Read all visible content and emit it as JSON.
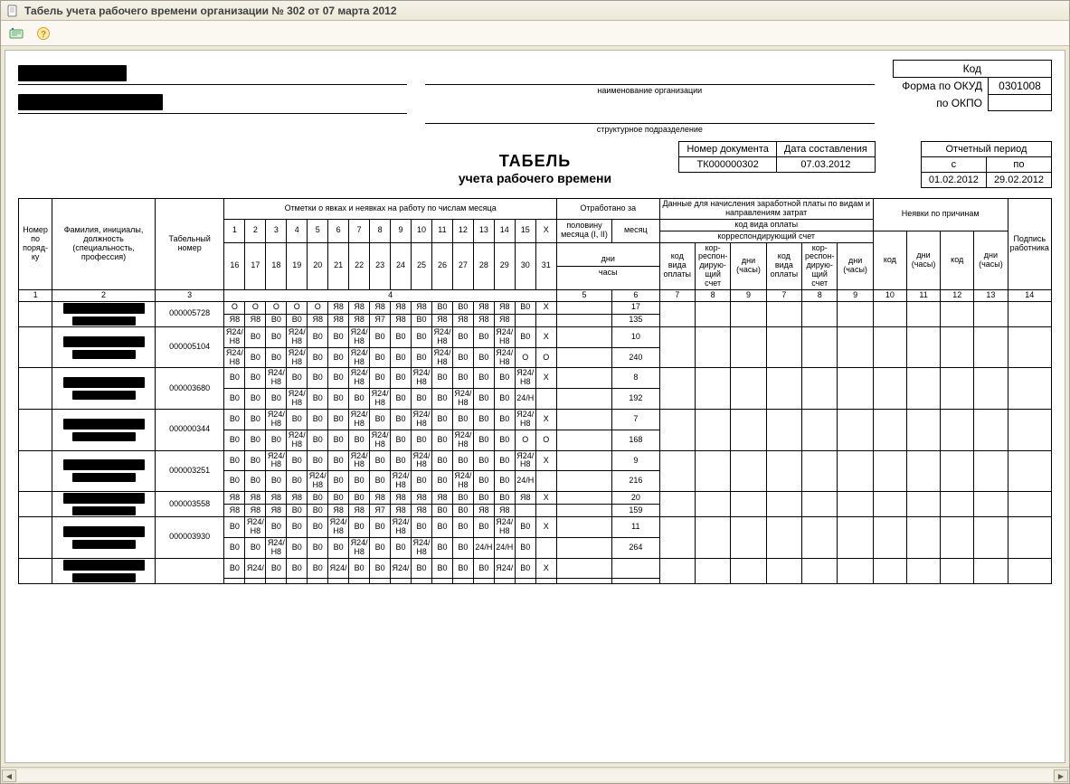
{
  "window": {
    "title": "Табель учета рабочего времени организации № 302 от 07 марта 2012"
  },
  "header": {
    "org_label": "наименование организации",
    "dept_label": "структурное подразделение",
    "form_okud_label": "Форма по ОКУД",
    "form_okpo_label": "по ОКПО",
    "code_label": "Код",
    "okud_code": "0301008",
    "okpo_code": ""
  },
  "title": {
    "line1": "ТАБЕЛЬ",
    "line2": "учета  рабочего времени"
  },
  "docmeta": {
    "doc_number_label": "Номер документа",
    "doc_date_label": "Дата составления",
    "doc_number": "ТК000000302",
    "doc_date": "07.03.2012",
    "period_label": "Отчетный период",
    "from_label": "с",
    "to_label": "по",
    "period_from": "01.02.2012",
    "period_to": "29.02.2012"
  },
  "columns": {
    "h_marks": "Отметки о явках и неявках на работу по числам месяца",
    "h_worked": "Отработано за",
    "h_pay": "Данные для начисления заработной платы по видам и направлениям затрат",
    "h_absence": "Неявки по причинам",
    "h_sign": "Подпись работника",
    "num": "Номер по поряд- ку",
    "fio": "Фамилия, инициалы, должность (специальность, профессия)",
    "tab": "Табельный номер",
    "half": "половину месяца (I, II)",
    "month": "месяц",
    "days": "дни",
    "hours": "часы",
    "paytype": "код вида оплаты",
    "corr": "корреспондирующий счет",
    "paycode": "код вида оплаты",
    "corr_acc": "кор- респон- дирую- щий счет",
    "dh": "дни (часы)",
    "code": "код",
    "day_numbers_r1": [
      "1",
      "2",
      "3",
      "4",
      "5",
      "6",
      "7",
      "8",
      "9",
      "10",
      "11",
      "12",
      "13",
      "14",
      "15",
      "X"
    ],
    "day_numbers_r2": [
      "16",
      "17",
      "18",
      "19",
      "20",
      "21",
      "22",
      "23",
      "24",
      "25",
      "26",
      "27",
      "28",
      "29",
      "30",
      "31"
    ],
    "col_nums": [
      "1",
      "2",
      "3",
      "4",
      "5",
      "6",
      "7",
      "8",
      "9",
      "7",
      "8",
      "9",
      "10",
      "11",
      "12",
      "13",
      "14"
    ]
  },
  "rows": [
    {
      "tab_no": "000005728",
      "r1": [
        "О",
        "О",
        "О",
        "О",
        "О",
        "Я8",
        "Я8",
        "Я8",
        "Я8",
        "Я8",
        "В0",
        "В0",
        "Я8",
        "Я8",
        "В0",
        "X"
      ],
      "r2": [
        "Я8",
        "Я8",
        "В0",
        "В0",
        "Я8",
        "Я8",
        "Я8",
        "Я7",
        "Я8",
        "В0",
        "Я8",
        "Я8",
        "Я8",
        "Я8",
        "",
        ""
      ],
      "month_days": "17",
      "month_hours": "135"
    },
    {
      "tab_no": "000005104",
      "r1": [
        "Я24/ Н8",
        "В0",
        "В0",
        "Я24/ Н8",
        "В0",
        "В0",
        "Я24/ Н8",
        "В0",
        "В0",
        "В0",
        "Я24/ Н8",
        "В0",
        "В0",
        "Я24/ Н8",
        "В0",
        "X"
      ],
      "r2": [
        "Я24/ Н8",
        "В0",
        "В0",
        "Я24/ Н8",
        "В0",
        "В0",
        "Я24/ Н8",
        "В0",
        "В0",
        "В0",
        "Я24/ Н8",
        "В0",
        "В0",
        "Я24/ Н8",
        "О",
        "О"
      ],
      "month_days": "10",
      "month_hours": "240"
    },
    {
      "tab_no": "000003680",
      "r1": [
        "В0",
        "В0",
        "Я24/ Н8",
        "В0",
        "В0",
        "В0",
        "Я24/ Н8",
        "В0",
        "В0",
        "Я24/ Н8",
        "В0",
        "В0",
        "В0",
        "В0",
        "Я24/ Н8",
        "X"
      ],
      "r2": [
        "В0",
        "В0",
        "В0",
        "Я24/ Н8",
        "В0",
        "В0",
        "В0",
        "Я24/ Н8",
        "В0",
        "В0",
        "В0",
        "Я24/ Н8",
        "В0",
        "В0",
        "24/Н",
        ""
      ],
      "month_days": "8",
      "month_hours": "192"
    },
    {
      "tab_no": "000000344",
      "r1": [
        "В0",
        "В0",
        "Я24/ Н8",
        "В0",
        "В0",
        "В0",
        "Я24/ Н8",
        "В0",
        "В0",
        "Я24/ Н8",
        "В0",
        "В0",
        "В0",
        "В0",
        "Я24/ Н8",
        "X"
      ],
      "r2": [
        "В0",
        "В0",
        "В0",
        "Я24/ Н8",
        "В0",
        "В0",
        "В0",
        "Я24/ Н8",
        "В0",
        "В0",
        "В0",
        "Я24/ Н8",
        "В0",
        "В0",
        "О",
        "О"
      ],
      "month_days": "7",
      "month_hours": "168"
    },
    {
      "tab_no": "000003251",
      "r1": [
        "В0",
        "В0",
        "Я24/ Н8",
        "В0",
        "В0",
        "В0",
        "Я24/ Н8",
        "В0",
        "В0",
        "Я24/ Н8",
        "В0",
        "В0",
        "В0",
        "В0",
        "Я24/ Н8",
        "X"
      ],
      "r2": [
        "В0",
        "В0",
        "В0",
        "В0",
        "Я24/ Н8",
        "В0",
        "В0",
        "В0",
        "Я24/ Н8",
        "В0",
        "В0",
        "Я24/ Н8",
        "В0",
        "В0",
        "24/Н",
        ""
      ],
      "month_days": "9",
      "month_hours": "216"
    },
    {
      "tab_no": "000003558",
      "r1": [
        "Я8",
        "Я8",
        "Я8",
        "Я8",
        "В0",
        "В0",
        "В0",
        "Я8",
        "Я8",
        "Я8",
        "Я8",
        "В0",
        "В0",
        "В0",
        "Я8",
        "X"
      ],
      "r2": [
        "Я8",
        "Я8",
        "Я8",
        "В0",
        "В0",
        "Я8",
        "Я8",
        "Я7",
        "Я8",
        "Я8",
        "В0",
        "В0",
        "Я8",
        "Я8",
        "",
        ""
      ],
      "month_days": "20",
      "month_hours": "159"
    },
    {
      "tab_no": "000003930",
      "r1": [
        "В0",
        "Я24/ Н8",
        "В0",
        "В0",
        "В0",
        "Я24/ Н8",
        "В0",
        "В0",
        "Я24/ Н8",
        "В0",
        "В0",
        "В0",
        "В0",
        "Я24/ Н8",
        "В0",
        "X"
      ],
      "r2": [
        "В0",
        "В0",
        "Я24/ Н8",
        "В0",
        "В0",
        "В0",
        "Я24/ Н8",
        "В0",
        "В0",
        "Я24/ Н8",
        "В0",
        "В0",
        "24/Н",
        "24/Н",
        "В0",
        ""
      ],
      "month_days": "11",
      "month_hours": "264"
    },
    {
      "tab_no": "",
      "r1": [
        "В0",
        "Я24/",
        "В0",
        "В0",
        "В0",
        "Я24/",
        "В0",
        "В0",
        "Я24/",
        "В0",
        "В0",
        "В0",
        "В0",
        "Я24/",
        "В0",
        "X"
      ],
      "r2": [],
      "month_days": "",
      "month_hours": ""
    }
  ]
}
